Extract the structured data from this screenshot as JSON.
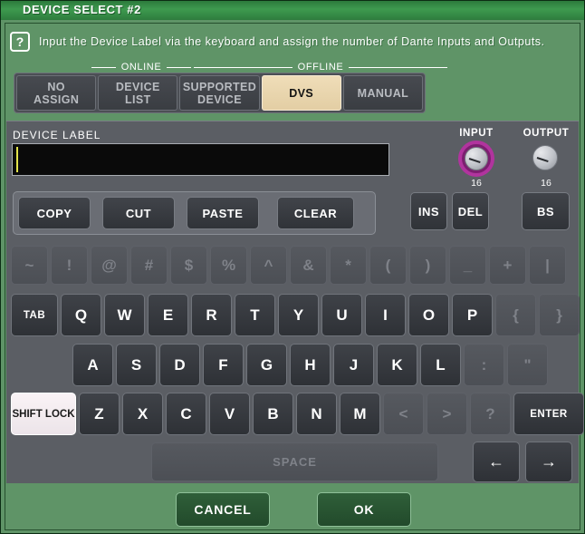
{
  "window": {
    "title": "DEVICE SELECT #2"
  },
  "help": {
    "icon": "question-mark-icon",
    "text": "Input the Device Label via the keyboard and assign the number of Dante Inputs and Outputs."
  },
  "groups": {
    "online_label": "ONLINE",
    "offline_label": "OFFLINE"
  },
  "tabs": [
    {
      "label_line1": "NO",
      "label_line2": "ASSIGN",
      "selected": false
    },
    {
      "label_line1": "DEVICE",
      "label_line2": "LIST",
      "selected": false
    },
    {
      "label_line1": "SUPPORTED",
      "label_line2": "DEVICE",
      "selected": false
    },
    {
      "label_line1": "DVS",
      "label_line2": "",
      "selected": true
    },
    {
      "label_line1": "MANUAL",
      "label_line2": "",
      "selected": false
    }
  ],
  "device_label": {
    "caption": "DEVICE LABEL",
    "value": "",
    "placeholder": ""
  },
  "knobs": {
    "input": {
      "label": "INPUT",
      "value": "16",
      "selected": true
    },
    "output": {
      "label": "OUTPUT",
      "value": "16",
      "selected": false
    }
  },
  "edit_buttons": [
    {
      "label": "COPY"
    },
    {
      "label": "CUT"
    },
    {
      "label": "PASTE"
    },
    {
      "label": "CLEAR"
    }
  ],
  "cursor_buttons": [
    {
      "label": "INS"
    },
    {
      "label": "DEL"
    }
  ],
  "backspace": {
    "label": "BS"
  },
  "keyboard": {
    "row_symbols": [
      {
        "label": "~",
        "enabled": false
      },
      {
        "label": "!",
        "enabled": false
      },
      {
        "label": "@",
        "enabled": false
      },
      {
        "label": "#",
        "enabled": false
      },
      {
        "label": "$",
        "enabled": false
      },
      {
        "label": "%",
        "enabled": false
      },
      {
        "label": "^",
        "enabled": false
      },
      {
        "label": "&",
        "enabled": false
      },
      {
        "label": "*",
        "enabled": false
      },
      {
        "label": "(",
        "enabled": false
      },
      {
        "label": ")",
        "enabled": false
      },
      {
        "label": "_",
        "enabled": false
      },
      {
        "label": "+",
        "enabled": false
      },
      {
        "label": "|",
        "enabled": false
      }
    ],
    "row_top": [
      {
        "label": "TAB",
        "enabled": true,
        "size": "small"
      },
      {
        "label": "Q",
        "enabled": true
      },
      {
        "label": "W",
        "enabled": true
      },
      {
        "label": "E",
        "enabled": true
      },
      {
        "label": "R",
        "enabled": true
      },
      {
        "label": "T",
        "enabled": true
      },
      {
        "label": "Y",
        "enabled": true
      },
      {
        "label": "U",
        "enabled": true
      },
      {
        "label": "I",
        "enabled": true
      },
      {
        "label": "O",
        "enabled": true
      },
      {
        "label": "P",
        "enabled": true
      },
      {
        "label": "{",
        "enabled": false
      },
      {
        "label": "}",
        "enabled": false
      }
    ],
    "row_home": [
      {
        "label": "A",
        "enabled": true
      },
      {
        "label": "S",
        "enabled": true
      },
      {
        "label": "D",
        "enabled": true
      },
      {
        "label": "F",
        "enabled": true
      },
      {
        "label": "G",
        "enabled": true
      },
      {
        "label": "H",
        "enabled": true
      },
      {
        "label": "J",
        "enabled": true
      },
      {
        "label": "K",
        "enabled": true
      },
      {
        "label": "L",
        "enabled": true
      },
      {
        "label": ":",
        "enabled": false
      },
      {
        "label": "\"",
        "enabled": false
      }
    ],
    "row_bottom": [
      {
        "label": "SHIFT LOCK",
        "enabled": true,
        "state": "on",
        "size": "small"
      },
      {
        "label": "Z",
        "enabled": true
      },
      {
        "label": "X",
        "enabled": true
      },
      {
        "label": "C",
        "enabled": true
      },
      {
        "label": "V",
        "enabled": true
      },
      {
        "label": "B",
        "enabled": true
      },
      {
        "label": "N",
        "enabled": true
      },
      {
        "label": "M",
        "enabled": true
      },
      {
        "label": "<",
        "enabled": false
      },
      {
        "label": ">",
        "enabled": false
      },
      {
        "label": "?",
        "enabled": false
      },
      {
        "label": "ENTER",
        "enabled": true,
        "size": "small"
      }
    ],
    "space": {
      "label": "SPACE",
      "enabled": false
    },
    "arrow_left": {
      "label": "←",
      "enabled": true
    },
    "arrow_right": {
      "label": "→",
      "enabled": true
    }
  },
  "footer": {
    "cancel_label": "CANCEL",
    "ok_label": "OK"
  },
  "colors": {
    "window_green": "#5f9467",
    "title_green": "#3e9a4f",
    "panel_gray": "#5b5e64",
    "key_dark": "#3a3d42",
    "selected_tab": "#e8d5ae",
    "knob_accent": "#b1349e",
    "caret_yellow": "#e3e34a",
    "footer_button_green": "#2f5f39"
  }
}
